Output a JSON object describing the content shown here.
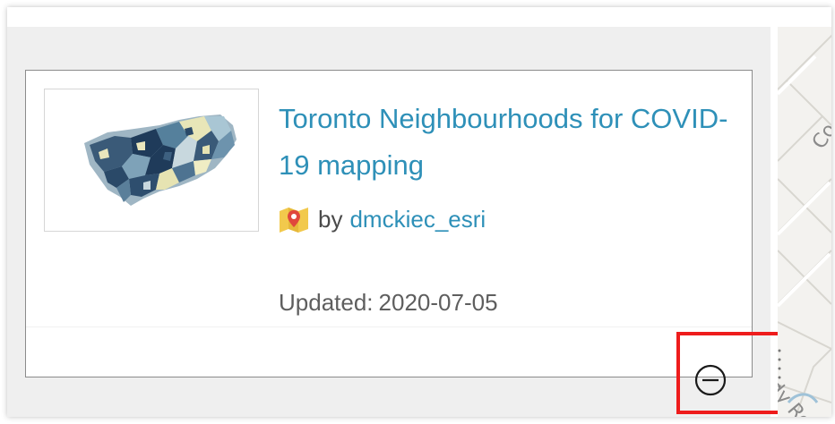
{
  "item": {
    "title": "Toronto Neighbourhoods for COVID-19 mapping",
    "by_label": "by",
    "owner": "dmckiec_esri",
    "updated_label": "Updated:",
    "updated_date": "2020-07-05"
  },
  "icons": {
    "item_type": "map-icon",
    "remove": "minus-circle-icon"
  },
  "map_labels": {
    "label_1": "Co",
    "label_2": "edy Ro"
  },
  "colors": {
    "link": "#2e90b8",
    "highlight": "#ee1c1c",
    "card_border": "#8b8b8b",
    "panel_bg": "#efefef"
  }
}
